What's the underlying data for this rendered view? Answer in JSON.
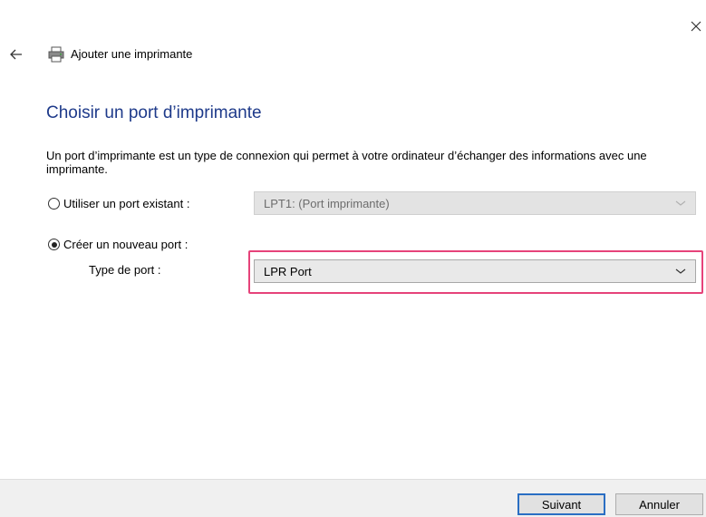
{
  "window": {
    "title": "Ajouter une imprimante"
  },
  "page": {
    "title": "Choisir un port d’imprimante",
    "description": "Un port d’imprimante est un type de connexion qui permet à votre ordinateur d’échanger des informations avec une imprimante."
  },
  "options": {
    "existing_port_label": "Utiliser un port existant :",
    "existing_port_value": "LPT1: (Port imprimante)",
    "new_port_label": "Créer un nouveau port :",
    "port_type_label": "Type de port :",
    "port_type_value": "LPR Port",
    "selected": "new_port"
  },
  "footer": {
    "next_label": "Suivant",
    "cancel_label": "Annuler"
  },
  "colors": {
    "accent": "#1e3a8a",
    "highlight": "#e6437a",
    "focus": "#2a6ec3"
  },
  "icons": {
    "close": "close-icon",
    "back": "back-arrow-icon",
    "printer": "printer-icon",
    "dropdown": "chevron-down-icon"
  }
}
